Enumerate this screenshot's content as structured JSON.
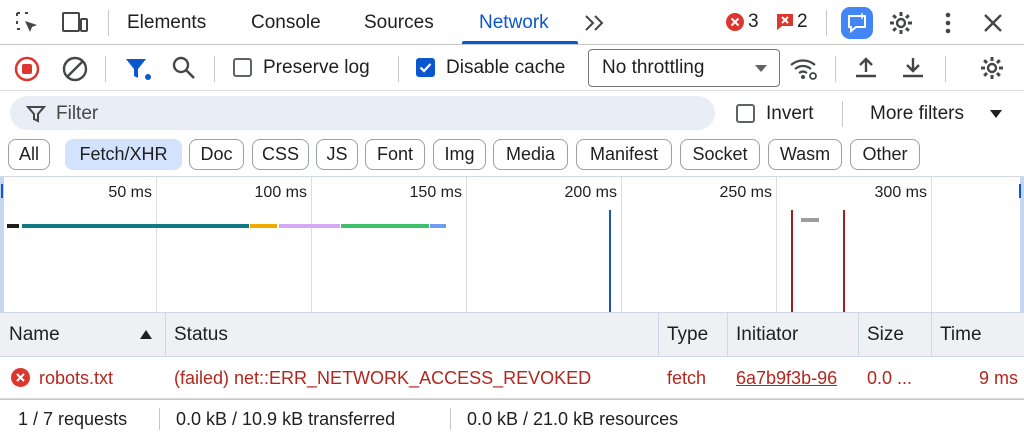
{
  "tabs": {
    "items": [
      "Elements",
      "Console",
      "Sources",
      "Network"
    ],
    "active": "Network"
  },
  "counters": {
    "errors": "3",
    "warnings": "2"
  },
  "toolbar": {
    "preserve_log_label": "Preserve log",
    "preserve_log_checked": false,
    "disable_cache_label": "Disable cache",
    "disable_cache_checked": true,
    "throttling_value": "No throttling"
  },
  "filter": {
    "placeholder": "Filter",
    "invert_label": "Invert",
    "more_filters_label": "More filters"
  },
  "type_chips": [
    "All",
    "Fetch/XHR",
    "Doc",
    "CSS",
    "JS",
    "Font",
    "Img",
    "Media",
    "Manifest",
    "Socket",
    "Wasm",
    "Other"
  ],
  "active_chip": "Fetch/XHR",
  "overview": {
    "ticks": [
      "50 ms",
      "100 ms",
      "150 ms",
      "200 ms",
      "250 ms",
      "300 ms"
    ]
  },
  "table": {
    "columns": [
      "Name",
      "Status",
      "Type",
      "Initiator",
      "Size",
      "Time"
    ],
    "rows": [
      {
        "name": "robots.txt",
        "status": "(failed) net::ERR_NETWORK_ACCESS_REVOKED",
        "type": "fetch",
        "initiator": "6a7b9f3b-96",
        "size": "0.0 ...",
        "time": "9 ms"
      }
    ]
  },
  "footer": {
    "requests": "1 / 7 requests",
    "transferred": "0.0 kB / 10.9 kB transferred",
    "resources": "0.0 kB / 21.0 kB resources"
  },
  "colors": {
    "accent": "#0b57d0",
    "error": "#b3261e",
    "active_chip": "#d3e3fd"
  }
}
